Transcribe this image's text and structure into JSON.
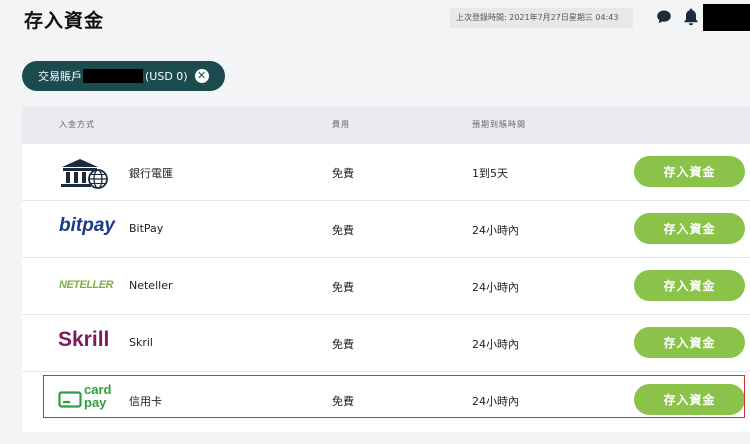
{
  "header": {
    "title": "存入資金",
    "last_login": "上次登錄時間: 2021年7月27日星期三 04:43"
  },
  "account": {
    "prefix": "交易賬戶",
    "balance": "(USD 0)"
  },
  "table": {
    "col_method": "入金方式",
    "col_fee": "費用",
    "col_time": "預期到賬時間",
    "rows": [
      {
        "name": "銀行電匯",
        "fee": "免費",
        "time": "1到5天",
        "button": "存入資金"
      },
      {
        "name": "BitPay",
        "fee": "免費",
        "time": "24小時內",
        "button": "存入資金",
        "logo_text": "bitpay"
      },
      {
        "name": "Neteller",
        "fee": "免費",
        "time": "24小時內",
        "button": "存入資金",
        "logo_text": "NETELLER"
      },
      {
        "name": "Skril",
        "fee": "免費",
        "time": "24小時內",
        "button": "存入資金",
        "logo_text": "Skrill"
      },
      {
        "name": "信用卡",
        "fee": "免費",
        "time": "24小時內",
        "button": "存入資金",
        "logo_text_1": "card",
        "logo_text_2": "pay"
      }
    ]
  },
  "colors": {
    "accent_green": "#8bc34a",
    "pill_teal": "#1c4b4f",
    "highlight_red": "#d32f2f"
  }
}
